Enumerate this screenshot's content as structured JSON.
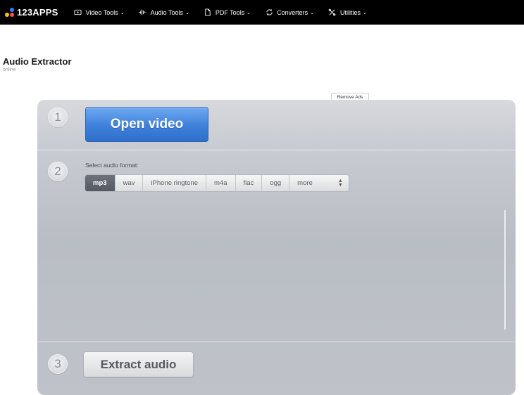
{
  "header": {
    "logo_text": "123APPS",
    "nav": [
      {
        "label": "Video Tools",
        "icon": "video-icon"
      },
      {
        "label": "Audio Tools",
        "icon": "audio-wave-icon"
      },
      {
        "label": "PDF Tools",
        "icon": "pdf-file-icon"
      },
      {
        "label": "Converters",
        "icon": "convert-icon"
      },
      {
        "label": "Utilities",
        "icon": "tools-icon"
      }
    ],
    "chevron": "⌄"
  },
  "page": {
    "title": "Audio Extractor",
    "subtitle": "online",
    "remove_ads": "Remove Ads"
  },
  "steps": {
    "one": {
      "number": "1",
      "button": "Open video"
    },
    "two": {
      "number": "2",
      "label": "Select audio format:",
      "formats": [
        "mp3",
        "wav",
        "iPhone ringtone",
        "m4a",
        "flac",
        "ogg",
        "more"
      ],
      "selected": "mp3"
    },
    "three": {
      "number": "3",
      "button": "Extract audio"
    }
  },
  "colors": {
    "topbar": "#000000",
    "open_button": "#3e80db",
    "active_format": "#5f646c"
  }
}
